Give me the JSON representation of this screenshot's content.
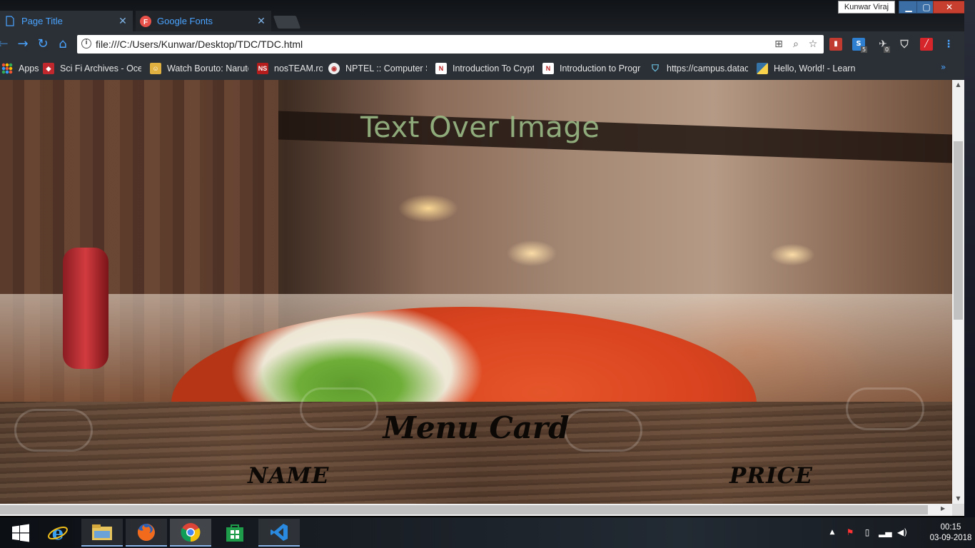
{
  "browser": {
    "tabs": [
      {
        "label": "Page Title",
        "icon": "page-icon",
        "active": true
      },
      {
        "label": "Google Fonts",
        "icon": "google-fonts-icon",
        "active": false
      }
    ],
    "profile_name": "Kunwar Viraj",
    "address": "file:///C:/Users/Kunwar/Desktop/TDC/TDC.html",
    "extension_badges": {
      "s_ext": "5",
      "puzzle_ext": "0"
    },
    "bookmarks": [
      {
        "label": "Apps",
        "icon": "apps-grid-icon"
      },
      {
        "label": "Sci Fi Archives - Ocea",
        "icon": "gamepad-icon"
      },
      {
        "label": "Watch Boruto: Naruto",
        "icon": "anime-icon"
      },
      {
        "label": "nosTEAM.ro",
        "icon": "ns-icon"
      },
      {
        "label": "NPTEL :: Computer Sc",
        "icon": "nptel-icon"
      },
      {
        "label": "Introduction To Crypt",
        "icon": "n-icon"
      },
      {
        "label": "Introduction to Progr",
        "icon": "n-icon"
      },
      {
        "label": "https://campus.datac",
        "icon": "shield-icon"
      },
      {
        "label": "Hello, World! - Learn",
        "icon": "python-icon"
      }
    ]
  },
  "page": {
    "hero_title": "Text Over Image",
    "menu_title": "Menu Card",
    "columns": {
      "name": "NAME",
      "price": "PRICE"
    }
  },
  "taskbar": {
    "apps": [
      "windows-start-icon",
      "internet-explorer-icon",
      "file-explorer-icon",
      "firefox-icon",
      "chrome-icon",
      "store-icon",
      "vscode-icon"
    ],
    "time": "00:15",
    "date": "03-09-2018"
  },
  "colors": {
    "tab_text": "#4aa3ff",
    "hero_title": "#a0c38c",
    "menu_text": "#0b0806"
  }
}
